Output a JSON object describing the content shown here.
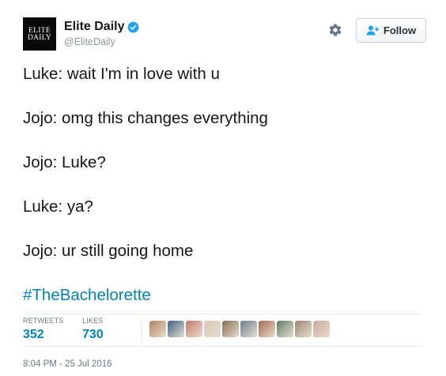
{
  "account": {
    "display_name": "Elite Daily",
    "handle": "@EliteDaily",
    "logo_line1": "ELITE",
    "logo_line2": "DAILY",
    "verified": true
  },
  "follow_button": {
    "label": "Follow"
  },
  "tweet": {
    "lines": [
      "Luke: wait I'm in love with u",
      "Jojo: omg this changes everything",
      "Jojo: Luke?",
      "Luke: ya?",
      "Jojo: ur still going home"
    ],
    "hashtag": "#TheBachelorette"
  },
  "stats": {
    "retweets_label": "RETWEETS",
    "retweets_value": "352",
    "likes_label": "LIKES",
    "likes_value": "730"
  },
  "liked_by_avatars": [
    {
      "color": "#b7825f"
    },
    {
      "color": "#3f5f87"
    },
    {
      "color": "#c47a6a"
    },
    {
      "color": "#d8c7b3"
    },
    {
      "color": "#8a6a55"
    },
    {
      "color": "#6b7f8f"
    },
    {
      "color": "#a6694f"
    },
    {
      "color": "#5f7c66"
    },
    {
      "color": "#9b8470"
    },
    {
      "color": "#c9a99a"
    }
  ],
  "timestamp": "8:04 PM - 25 Jul 2016",
  "colors": {
    "link": "#0084b4",
    "verified": "#1da1f2",
    "text": "#14171a",
    "muted": "#657786"
  },
  "icons": [
    "verified-badge-icon",
    "gear-icon",
    "follow-person-plus-icon"
  ]
}
